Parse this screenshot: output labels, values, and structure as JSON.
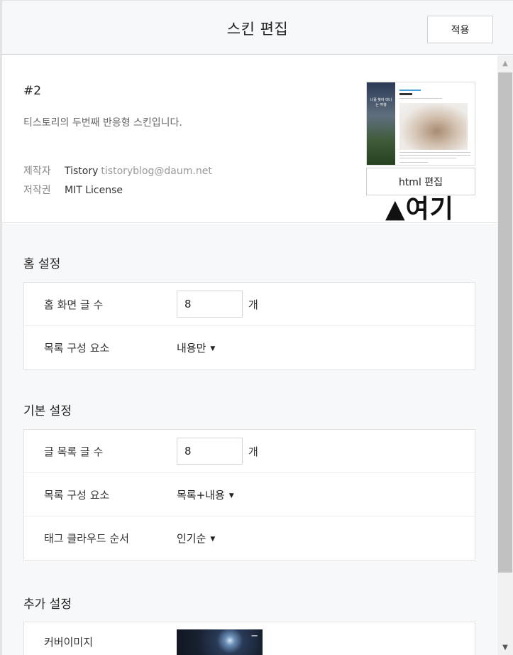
{
  "header": {
    "title": "스킨 편집",
    "apply_label": "적용"
  },
  "skin": {
    "name": "#2",
    "description": "티스토리의 두번째 반응형 스킨입니다.",
    "author_label": "제작자",
    "author_name": "Tistory",
    "author_email": "tistoryblog@daum.net",
    "license_label": "저작권",
    "license_value": "MIT License",
    "thumbnail_text": "나를 찾아 떠나는 여행",
    "thumbnail_heading": "블로그 포스트",
    "html_edit_label": "html 편집",
    "annotation": "▲여기"
  },
  "home_settings": {
    "title": "홈 설정",
    "post_count_label": "홈 화면 글 수",
    "post_count_value": "8",
    "post_count_unit": "개",
    "list_element_label": "목록 구성 요소",
    "list_element_value": "내용만"
  },
  "basic_settings": {
    "title": "기본 설정",
    "list_count_label": "글 목록 글 수",
    "list_count_value": "8",
    "list_count_unit": "개",
    "list_element_label": "목록 구성 요소",
    "list_element_value": "목록+내용",
    "tag_cloud_label": "태그 클라우드 순서",
    "tag_cloud_value": "인기순"
  },
  "extra_settings": {
    "title": "추가 설정",
    "cover_image_label": "커버이미지",
    "cover_remove": "−"
  },
  "icons": {
    "caret": "dropdown-caret-icon",
    "scroll_up": "scroll-up-arrow-icon",
    "scroll_down": "scroll-down-arrow-icon"
  }
}
